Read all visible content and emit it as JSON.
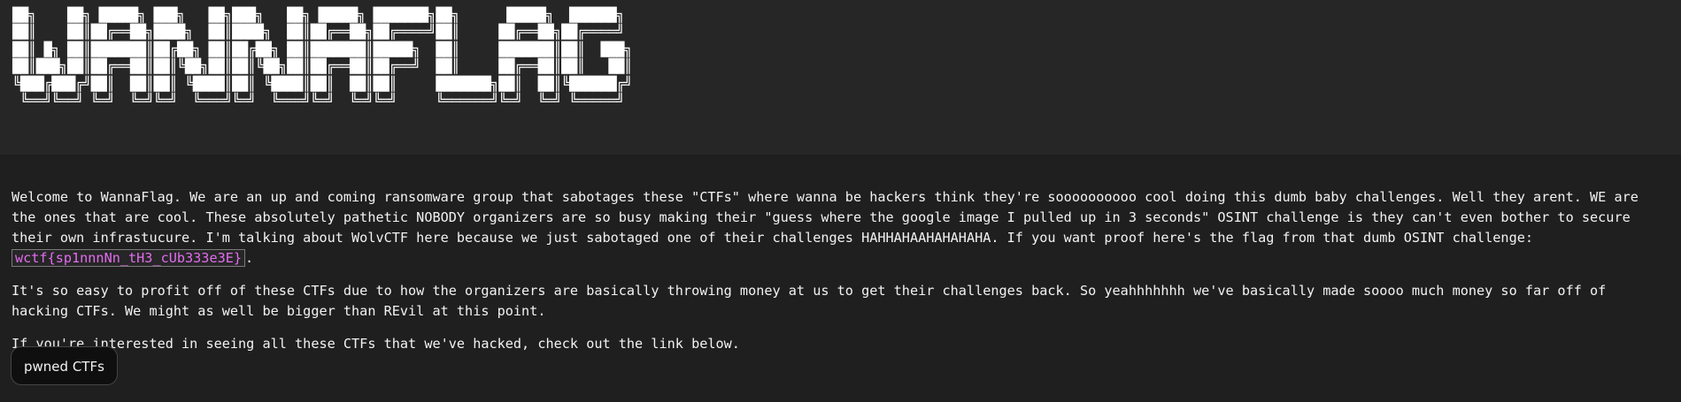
{
  "header": {
    "ascii_logo": "██╗    ██╗ █████╗ ███╗   ██╗███╗   ██╗ █████╗ ███████╗██╗      █████╗  ██████╗ \n██║    ██║██╔══██╗████╗  ██║████╗  ██║██╔══██╗██╔════╝██║     ██╔══██╗██╔════╝ \n██║ █╗ ██║███████║██╔██╗ ██║██╔██╗ ██║███████║█████╗  ██║     ███████║██║  ███╗\n██║███╗██║██╔══██║██║╚██╗██║██║╚██╗██║██╔══██║██╔══╝  ██║     ██╔══██║██║   ██║\n╚███╔███╔╝██║  ██║██║ ╚████║██║ ╚████║██║  ██║██║     ███████╗██║  ██║╚██████╔╝\n ╚══╝╚══╝ ╚═╝  ╚═╝╚═╝  ╚═══╝╚═╝  ╚═══╝╚═╝  ╚═╝╚═╝     ╚══════╝╚═╝  ╚═╝ ╚═════╝ "
  },
  "main": {
    "paragraph1_text": "Welcome to WannaFlag. We are an up and coming ransomware group that sabotages these \"CTFs\" where wanna be hackers think they're soooooooooo cool doing this dumb baby challenges. Well they arent. WE are the ones that are cool. These absolutely pathetic NOBODY organizers are so busy making their \"guess where the google image I pulled up in 3 seconds\" OSINT challenge is they can't even bother to secure their own infrastucure. I'm talking about WolvCTF here because we just sabotaged one of their challenges HAHHAHAAHAHAHAHA. If you want proof here's the flag from that dumb OSINT challenge: ",
    "flag": "wctf{sp1nnnNn_tH3_cUb333e3E}",
    "paragraph1_end": ".",
    "paragraph2": "It's so easy to profit off of these CTFs due to how the organizers are basically throwing money at us to get their challenges back. So yeahhhhhhh we've basically made soooo much money so far off of hacking CTFs. We might as well be bigger than REvil at this point.",
    "paragraph3": "If you're interested in seeing all these CTFs that we've hacked, check out the link below.",
    "button_label": "pwned CTFs"
  },
  "colors": {
    "background": "#1f1f1f",
    "header_background": "#262626",
    "flag_text": "#e36cf0"
  }
}
